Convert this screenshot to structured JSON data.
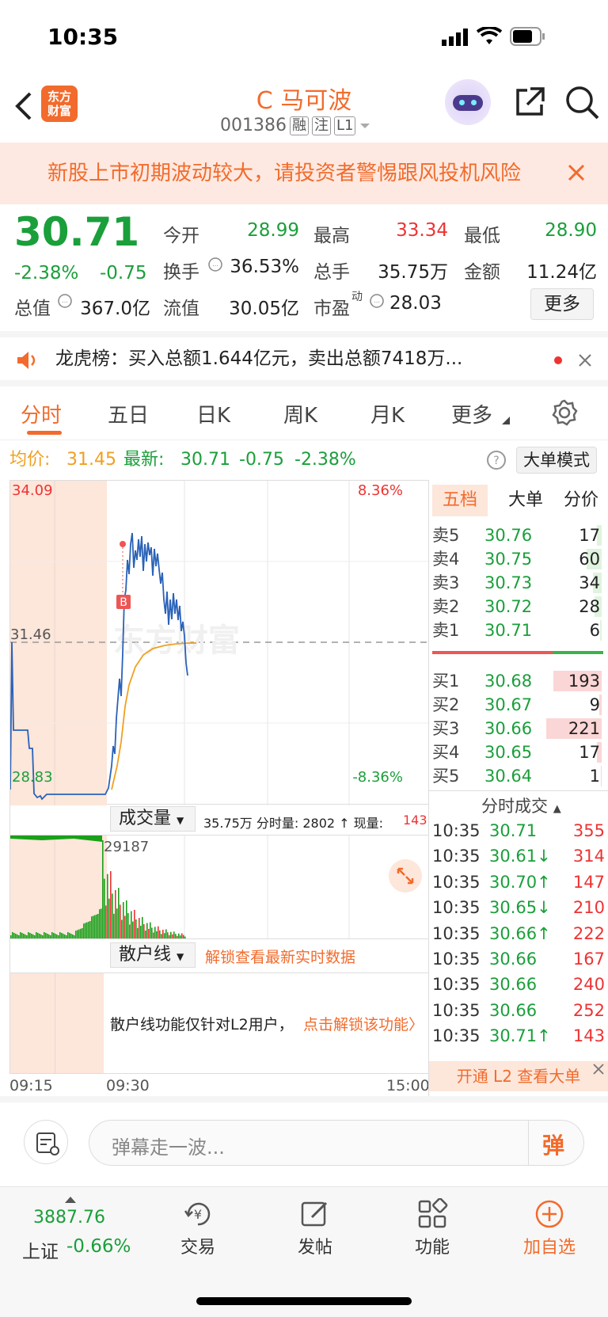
{
  "status": {
    "time": "10:35"
  },
  "header": {
    "logo": "东方\n财富",
    "title": "C 马可波",
    "code": "001386",
    "tags": [
      "融",
      "注",
      "L1"
    ]
  },
  "banner": {
    "text": "新股上市初期波动较大，请投资者警惕跟风投机风险"
  },
  "quote": {
    "price": "30.71",
    "pct": "-2.38%",
    "change": "-0.75",
    "fields": [
      {
        "label": "今开",
        "value": "28.99"
      },
      {
        "label": "最高",
        "value": "33.34"
      },
      {
        "label": "最低",
        "value": "28.90"
      },
      {
        "label": "换手",
        "value": "36.53%"
      },
      {
        "label": "总手",
        "value": "35.75万"
      },
      {
        "label": "金额",
        "value": "11.24亿"
      },
      {
        "label": "总值",
        "value": "367.0亿"
      },
      {
        "label": "流值",
        "value": "30.05亿"
      },
      {
        "label": "市盈",
        "value": "28.03",
        "sup": "动"
      }
    ],
    "more": "更多"
  },
  "lhb": {
    "text": "龙虎榜：买入总额1.644亿元，卖出总额7418万..."
  },
  "tabs": [
    "分时",
    "五日",
    "日K",
    "周K",
    "月K",
    "更多"
  ],
  "avg": {
    "avg_label": "均价:",
    "avg": "31.45",
    "latest_label": "最新:",
    "latest": "30.71",
    "chg": "-0.75",
    "pct": "-2.38%",
    "mode": "大单模式"
  },
  "chart": {
    "ymax": "34.09",
    "ymid": "31.46",
    "ymin": "28.83",
    "pmax": "8.36%",
    "pmin": "-8.36%",
    "watermark": "东方财富",
    "vol_label": "成交量",
    "vol_info": "35.75万 分时量: 2802 ↑ 现量:",
    "vol_now": "143",
    "vol_peak": "29187",
    "retail_label": "散户线",
    "retail_unlock": "解锁查看最新实时数据",
    "retail_msg": "散户线功能仅针对L2用户，",
    "retail_link": "点击解锁该功能〉",
    "t0": "09:15",
    "t1": "09:30",
    "t2": "15:00",
    "marker": "B"
  },
  "book": {
    "tabs": [
      "五档",
      "大单",
      "分价"
    ],
    "sells": [
      {
        "l": "卖5",
        "p": "30.76",
        "v": "17",
        "w": 0.08
      },
      {
        "l": "卖4",
        "p": "30.75",
        "v": "60",
        "w": 0.27
      },
      {
        "l": "卖3",
        "p": "30.73",
        "v": "34",
        "w": 0.15
      },
      {
        "l": "卖2",
        "p": "30.72",
        "v": "28",
        "w": 0.13
      },
      {
        "l": "卖1",
        "p": "30.71",
        "v": "6",
        "w": 0.03
      }
    ],
    "buys": [
      {
        "l": "买1",
        "p": "30.68",
        "v": "193",
        "w": 0.87
      },
      {
        "l": "买2",
        "p": "30.67",
        "v": "9",
        "w": 0.04
      },
      {
        "l": "买3",
        "p": "30.66",
        "v": "221",
        "w": 1.0
      },
      {
        "l": "买4",
        "p": "30.65",
        "v": "17",
        "w": 0.08
      },
      {
        "l": "买5",
        "p": "30.64",
        "v": "1",
        "w": 0.01
      }
    ],
    "trades_title": "分时成交",
    "trades": [
      {
        "t": "10:35",
        "p": "30.71",
        "v": "355"
      },
      {
        "t": "10:35",
        "p": "30.61↓",
        "v": "314"
      },
      {
        "t": "10:35",
        "p": "30.70↑",
        "v": "147"
      },
      {
        "t": "10:35",
        "p": "30.65↓",
        "v": "210"
      },
      {
        "t": "10:35",
        "p": "30.66↑",
        "v": "222"
      },
      {
        "t": "10:35",
        "p": "30.66",
        "v": "167"
      },
      {
        "t": "10:35",
        "p": "30.66",
        "v": "240"
      },
      {
        "t": "10:35",
        "p": "30.66",
        "v": "252"
      },
      {
        "t": "10:35",
        "p": "30.71↑",
        "v": "143"
      }
    ],
    "l2": "开通 L2 查看大单"
  },
  "comment": {
    "placeholder": "弹幕走一波...",
    "btn": "弹"
  },
  "bottom": {
    "index_val": "3887.76",
    "index_name": "上证",
    "index_pct": "-0.66%",
    "items": [
      "交易",
      "发帖",
      "功能",
      "加自选"
    ]
  },
  "colors": {
    "accent": "#f26b2c",
    "up": "#e33",
    "down": "#1a9f3a"
  }
}
